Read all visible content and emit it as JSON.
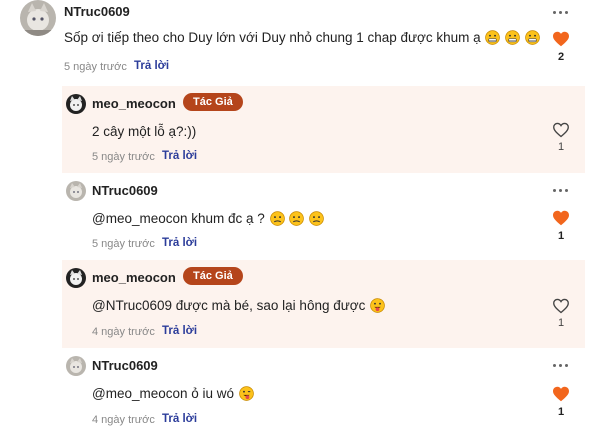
{
  "comments": [
    {
      "username": "NTruc0609",
      "content": "Sốp ơi tiếp theo cho Duy lớn với Duy nhỏ chung 1 chap được khum ạ",
      "time": "5 ngày trước",
      "reply_label": "Trả lời",
      "like_count": "2",
      "liked": true,
      "emojis": [
        "grimace-emoji",
        "grimace-emoji",
        "grimace-emoji"
      ]
    },
    {
      "username": "meo_meocon",
      "badge": "Tác Giả",
      "content": "2 cây một lỗ ạ?:))",
      "time": "5 ngày trước",
      "reply_label": "Trả lời",
      "like_count": "1",
      "liked": false
    },
    {
      "username": "NTruc0609",
      "content": "@meo_meocon khum đc ạ ?",
      "time": "5 ngày trước",
      "reply_label": "Trả lời",
      "like_count": "1",
      "liked": true,
      "emojis": [
        "confused-emoji",
        "confused-emoji",
        "confused-emoji"
      ]
    },
    {
      "username": "meo_meocon",
      "badge": "Tác Giả",
      "content": "@NTruc0609 được mà bé, sao lại hông được",
      "time": "4 ngày trước",
      "reply_label": "Trả lời",
      "like_count": "1",
      "liked": false,
      "emojis": [
        "tongue-out-emoji"
      ]
    },
    {
      "username": "NTruc0609",
      "content": "@meo_meocon ỏ iu wó",
      "time": "4 ngày trước",
      "reply_label": "Trả lời",
      "like_count": "1",
      "liked": true,
      "emojis": [
        "winking-tongue-emoji"
      ]
    }
  ],
  "colors": {
    "heart_filled": "#f2661d",
    "author_badge": "#b5451b",
    "reply_link": "#2b3c9a",
    "author_row_bg": "#fdf3ee"
  }
}
